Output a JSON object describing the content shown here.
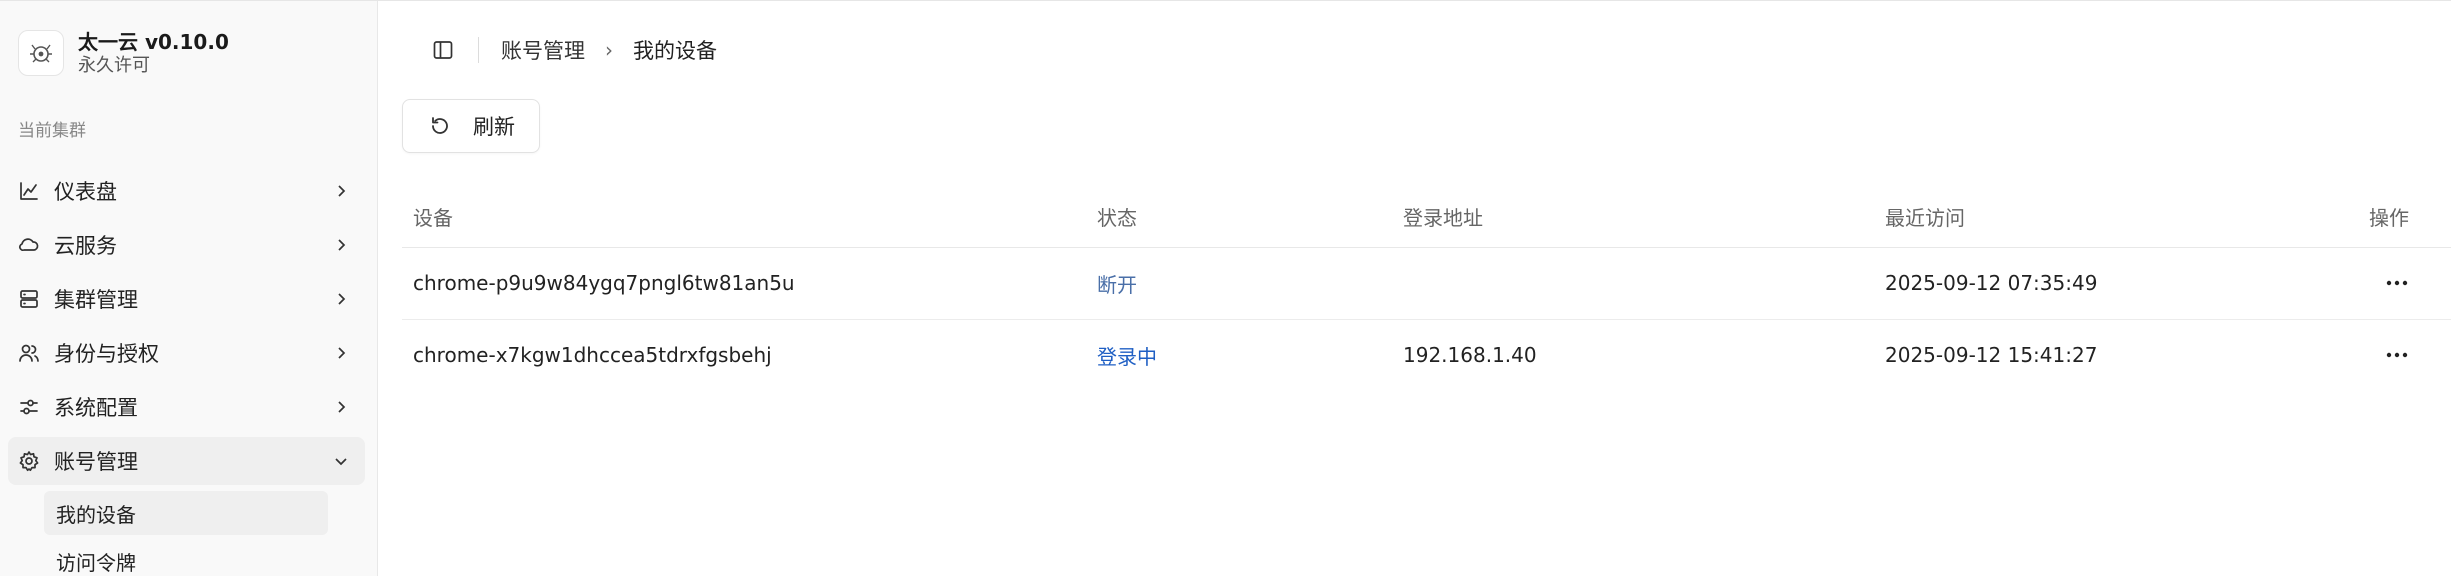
{
  "brand": {
    "title": "太一云 v0.10.0",
    "subtitle": "永久许可"
  },
  "sidebar": {
    "section_label": "当前集群",
    "items": [
      {
        "label": "仪表盘"
      },
      {
        "label": "云服务"
      },
      {
        "label": "集群管理"
      },
      {
        "label": "身份与授权"
      },
      {
        "label": "系统配置"
      },
      {
        "label": "账号管理",
        "expanded": true
      }
    ],
    "subitems": [
      {
        "label": "我的设备",
        "active": true
      },
      {
        "label": "访问令牌"
      }
    ]
  },
  "breadcrumb": {
    "parent": "账号管理",
    "current": "我的设备",
    "separator": "›"
  },
  "toolbar": {
    "refresh_label": "刷新"
  },
  "table": {
    "headers": {
      "device": "设备",
      "status": "状态",
      "address": "登录地址",
      "last_access": "最近访问",
      "actions": "操作"
    },
    "rows": [
      {
        "device": "chrome-p9u9w84ygq7pngl6tw81an5u",
        "status": "断开",
        "address": "",
        "last_access": "2025-09-12 07:35:49"
      },
      {
        "device": "chrome-x7kgw1dhccea5tdrxfgsbehj",
        "status": "登录中",
        "address": "192.168.1.40",
        "last_access": "2025-09-12 15:41:27"
      }
    ]
  },
  "colors": {
    "accent_link": "#1f5fc4",
    "sidebar_bg": "#f9f9f9",
    "active_bg": "#efefef"
  }
}
